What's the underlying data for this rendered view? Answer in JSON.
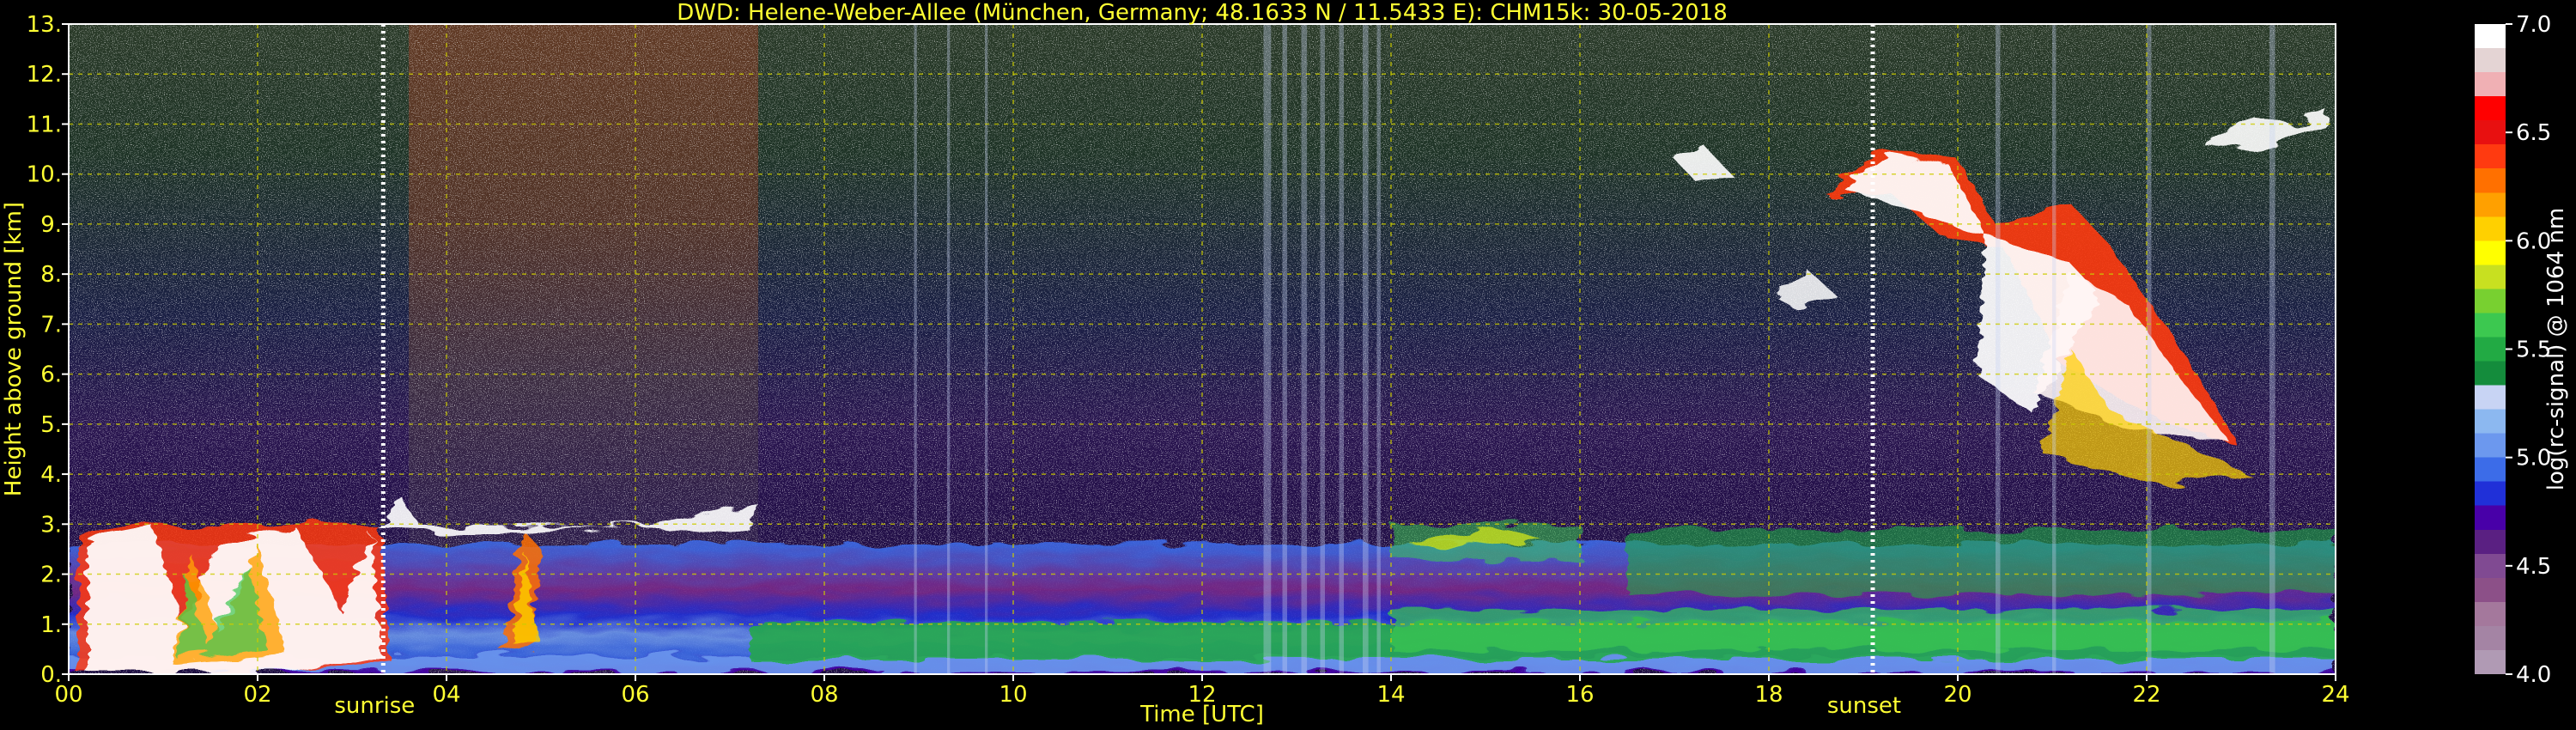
{
  "chart_data": {
    "type": "heatmap",
    "title": "DWD: Helene-Weber-Allee (München, Germany; 48.1633 N / 11.5433 E):    CHM15k: 30-05-2018",
    "xlabel": "Time [UTC]",
    "ylabel": "Height above ground [km]",
    "xlim": [
      0,
      24
    ],
    "ylim": [
      0,
      13
    ],
    "x_ticks": [
      "00",
      "02",
      "04",
      "06",
      "08",
      "10",
      "12",
      "14",
      "16",
      "18",
      "20",
      "22",
      "24"
    ],
    "y_ticks": [
      "0.",
      "1.",
      "2.",
      "3.",
      "4.",
      "5.",
      "6.",
      "7.",
      "8.",
      "9.",
      "10.",
      "11.",
      "12.",
      "13."
    ],
    "grid": true,
    "annotations": [
      {
        "label": "sunrise",
        "x": 3.33
      },
      {
        "label": "sunset",
        "x": 19.1
      }
    ],
    "colorbar": {
      "label": "log(rc-signal) @ 1064 nm",
      "range": [
        4.0,
        7.0
      ],
      "ticks": [
        "4.0",
        "4.5",
        "5.0",
        "5.5",
        "6.0",
        "6.5",
        "7.0"
      ],
      "colors": [
        "#b09ab4",
        "#a484a4",
        "#a4789c",
        "#8c5088",
        "#804a92",
        "#5a2082",
        "#4800a8",
        "#2030d8",
        "#3c6ce8",
        "#6c98ee",
        "#8cb8f0",
        "#c8d4f4",
        "#148c3c",
        "#22aa44",
        "#3cc850",
        "#78d030",
        "#c8e020",
        "#ffff00",
        "#ffd000",
        "#ffa000",
        "#ff7000",
        "#ff3a10",
        "#e81010",
        "#ff0000",
        "#f0b0b4",
        "#e4d4d4",
        "#ffffff"
      ]
    },
    "layers": [
      {
        "name": "boundary layer",
        "x": [
          0,
          24
        ],
        "y_top_km": [
          2.0,
          2.6
        ]
      },
      {
        "name": "low cloud",
        "x": [
          0,
          3.5
        ],
        "y_top_km": 3.0
      },
      {
        "name": "cloud edge",
        "x": [
          3.5,
          7.2
        ],
        "y_km": [
          2.9,
          3.4
        ]
      },
      {
        "name": "high cloud",
        "x": [
          17,
          24
        ],
        "y_km": [
          4.5,
          11.3
        ]
      }
    ]
  }
}
